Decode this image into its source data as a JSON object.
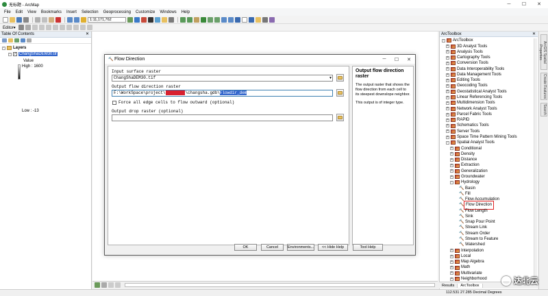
{
  "window": {
    "title": "无标题 - ArcMap"
  },
  "menu": [
    "File",
    "Edit",
    "View",
    "Bookmarks",
    "Insert",
    "Selection",
    "Geoprocessing",
    "Customize",
    "Windows",
    "Help"
  ],
  "toolbar": {
    "scale": "1:11,171,762",
    "editor_label": "Editor▾"
  },
  "toc": {
    "title": "Table Of Contents",
    "layers_label": "Layers",
    "layer_name": "ChangShaDEM30.tif",
    "value_label": "Value",
    "high_label": "High : 1600",
    "low_label": "Low : -13"
  },
  "dialog": {
    "title": "Flow Direction",
    "input_label": "Input surface raster",
    "input_value": "ChangShaDEM30.tif",
    "output_label": "Output flow direction raster",
    "output_prefix": "F:\\WorkSpace\\project\\",
    "output_redacted": "xxxxxxxx",
    "output_mid": "\\changsha.gdb\\",
    "output_selected": "Flowdir_dem",
    "force_label": "Force all edge cells to flow outward (optional)",
    "drop_label": "Output drop raster (optional)",
    "help_title": "Output flow direction raster",
    "help_text1": "The output raster that shows the flow direction from each cell to its steepest downslope neighbor.",
    "help_text2": "This output is of integer type.",
    "buttons": {
      "ok": "OK",
      "cancel": "Cancel",
      "env": "Environments...",
      "hide": "<< Hide Help",
      "toolhelp": "Tool Help"
    }
  },
  "toolbox": {
    "title": "ArcToolbox",
    "root": "ArcToolbox",
    "items": [
      {
        "label": "3D Analyst Tools",
        "level": 1,
        "kind": "box",
        "exp": "+"
      },
      {
        "label": "Analysis Tools",
        "level": 1,
        "kind": "box",
        "exp": "+"
      },
      {
        "label": "Cartography Tools",
        "level": 1,
        "kind": "box",
        "exp": "+"
      },
      {
        "label": "Conversion Tools",
        "level": 1,
        "kind": "box",
        "exp": "+"
      },
      {
        "label": "Data Interoperability Tools",
        "level": 1,
        "kind": "box",
        "exp": "+"
      },
      {
        "label": "Data Management Tools",
        "level": 1,
        "kind": "box",
        "exp": "+"
      },
      {
        "label": "Editing Tools",
        "level": 1,
        "kind": "box",
        "exp": "+"
      },
      {
        "label": "Geocoding Tools",
        "level": 1,
        "kind": "box",
        "exp": "+"
      },
      {
        "label": "Geostatistical Analyst Tools",
        "level": 1,
        "kind": "box",
        "exp": "+"
      },
      {
        "label": "Linear Referencing Tools",
        "level": 1,
        "kind": "box",
        "exp": "+"
      },
      {
        "label": "Multidimension Tools",
        "level": 1,
        "kind": "box",
        "exp": "+"
      },
      {
        "label": "Network Analyst Tools",
        "level": 1,
        "kind": "box",
        "exp": "+"
      },
      {
        "label": "Parcel Fabric Tools",
        "level": 1,
        "kind": "box",
        "exp": "+"
      },
      {
        "label": "RAPID",
        "level": 1,
        "kind": "box",
        "exp": "+"
      },
      {
        "label": "Schematics Tools",
        "level": 1,
        "kind": "box",
        "exp": "+"
      },
      {
        "label": "Server Tools",
        "level": 1,
        "kind": "box",
        "exp": "+"
      },
      {
        "label": "Space Time Pattern Mining Tools",
        "level": 1,
        "kind": "box",
        "exp": "+"
      },
      {
        "label": "Spatial Analyst Tools",
        "level": 1,
        "kind": "box",
        "exp": "-"
      },
      {
        "label": "Conditional",
        "level": 2,
        "kind": "box",
        "exp": "+"
      },
      {
        "label": "Density",
        "level": 2,
        "kind": "box",
        "exp": "+"
      },
      {
        "label": "Distance",
        "level": 2,
        "kind": "box",
        "exp": "+"
      },
      {
        "label": "Extraction",
        "level": 2,
        "kind": "box",
        "exp": "+"
      },
      {
        "label": "Generalization",
        "level": 2,
        "kind": "box",
        "exp": "+"
      },
      {
        "label": "Groundwater",
        "level": 2,
        "kind": "box",
        "exp": "+"
      },
      {
        "label": "Hydrology",
        "level": 2,
        "kind": "box",
        "exp": "-"
      },
      {
        "label": "Basin",
        "level": 3,
        "kind": "tool",
        "exp": ""
      },
      {
        "label": "Fill",
        "level": 3,
        "kind": "tool",
        "exp": ""
      },
      {
        "label": "Flow Accumulation",
        "level": 3,
        "kind": "tool",
        "exp": ""
      },
      {
        "label": "Flow Direction",
        "level": 3,
        "kind": "tool",
        "exp": "",
        "highlight": true
      },
      {
        "label": "Flow Length",
        "level": 3,
        "kind": "tool",
        "exp": ""
      },
      {
        "label": "Sink",
        "level": 3,
        "kind": "tool",
        "exp": ""
      },
      {
        "label": "Snap Pour Point",
        "level": 3,
        "kind": "tool",
        "exp": ""
      },
      {
        "label": "Stream Link",
        "level": 3,
        "kind": "tool",
        "exp": ""
      },
      {
        "label": "Stream Order",
        "level": 3,
        "kind": "tool",
        "exp": ""
      },
      {
        "label": "Stream to Feature",
        "level": 3,
        "kind": "tool",
        "exp": ""
      },
      {
        "label": "Watershed",
        "level": 3,
        "kind": "tool",
        "exp": ""
      },
      {
        "label": "Interpolation",
        "level": 2,
        "kind": "box",
        "exp": "+"
      },
      {
        "label": "Local",
        "level": 2,
        "kind": "box",
        "exp": "+"
      },
      {
        "label": "Map Algebra",
        "level": 2,
        "kind": "box",
        "exp": "+"
      },
      {
        "label": "Math",
        "level": 2,
        "kind": "box",
        "exp": "+"
      },
      {
        "label": "Multivariate",
        "level": 2,
        "kind": "box",
        "exp": "+"
      },
      {
        "label": "Neighborhood",
        "level": 2,
        "kind": "box",
        "exp": "+"
      }
    ],
    "tabs": [
      "Results",
      "ArcToolbox"
    ]
  },
  "side_tabs": [
    "ArcGIS Spatial Properties",
    "Create Features",
    "Search"
  ],
  "status": {
    "coords": "112.531  27.285 Decimal Degrees"
  },
  "watermark": "达北云"
}
